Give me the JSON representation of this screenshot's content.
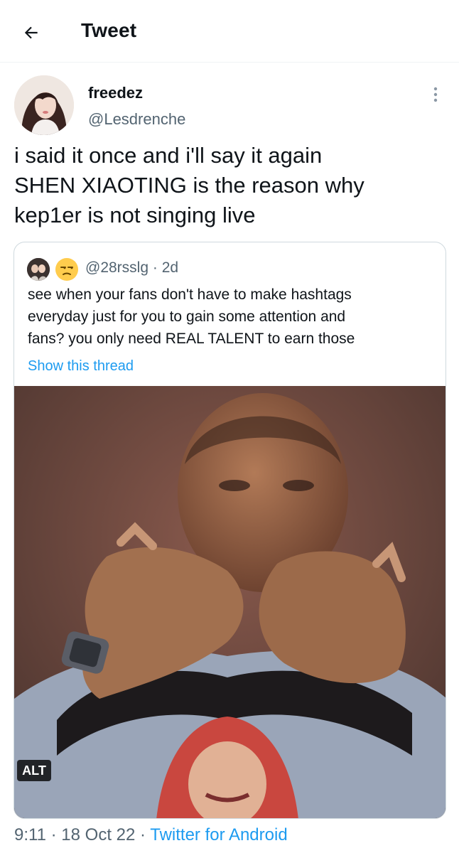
{
  "header": {
    "title": "Tweet",
    "back_icon": "arrow-left-icon"
  },
  "tweet": {
    "display_name": "freedez",
    "handle": "@Lesdrenche",
    "more_icon": "more-vertical-icon",
    "text_lines": [
      "i said it once and i'll say it again",
      "SHEN XIAOTING is the reason why",
      "kep1er is not singing live"
    ],
    "quote": {
      "emoji_icon": "unamused-face-emoji",
      "handle": "@28rsslg",
      "separator": "·",
      "age": "2d",
      "text_lines": [
        "see when your fans don't have to make hashtags",
        "everyday just for you to gain some attention and",
        "fans? you only need REAL TALENT to earn those"
      ],
      "show_thread": "Show this thread",
      "media_alt_badge": "ALT"
    },
    "footer": {
      "time": "9:11",
      "sep1": "·",
      "date": "18 Oct 22",
      "sep2": "·",
      "client": "Twitter for Android"
    }
  },
  "colors": {
    "link": "#1d9bf0",
    "secondary_text": "#536471",
    "border": "#cfd9de"
  }
}
